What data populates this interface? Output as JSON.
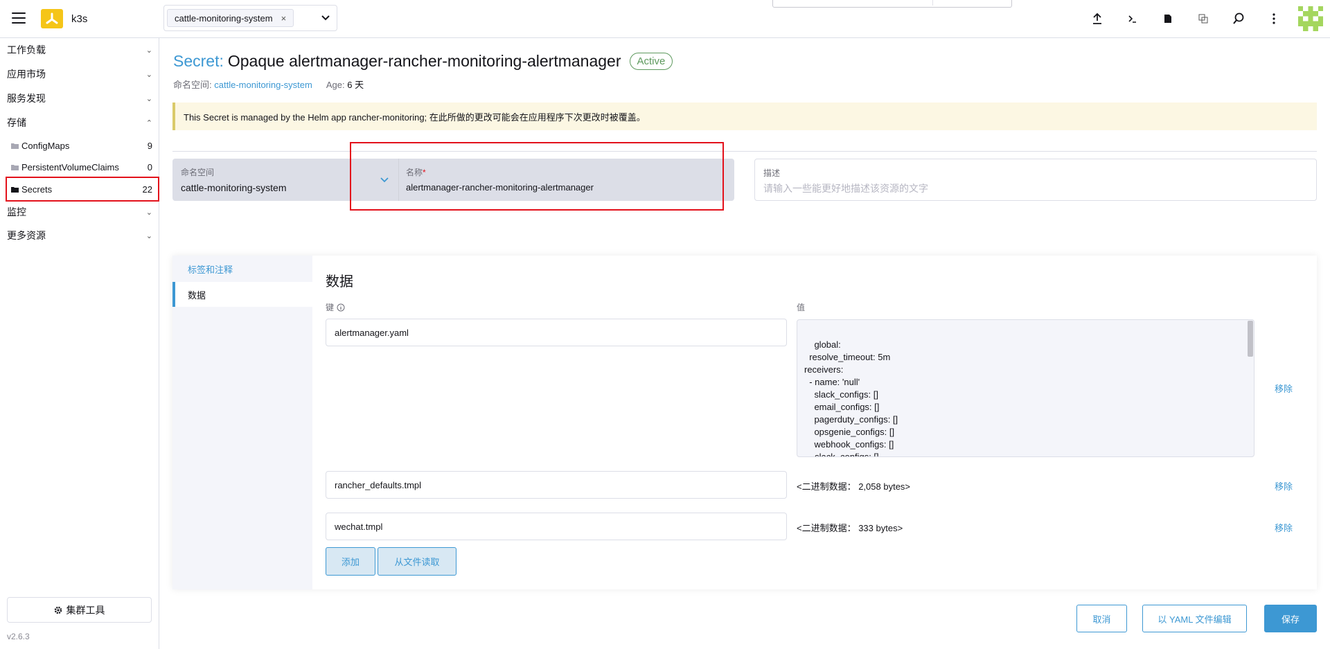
{
  "header": {
    "cluster_name": "k3s",
    "namespace_chip": "cattle-monitoring-system",
    "chip_remove": "×",
    "icons": [
      "upload-icon",
      "terminal-icon",
      "file-icon",
      "copy-icon",
      "search-icon",
      "more-icon"
    ]
  },
  "sidebar": {
    "groups": {
      "workload": "工作负载",
      "apps": "应用市场",
      "service_discovery": "服务发现",
      "storage": "存储",
      "monitoring": "监控",
      "more_resources": "更多资源"
    },
    "items": [
      {
        "label": "ConfigMaps",
        "count": "9"
      },
      {
        "label": "PersistentVolumeClaims",
        "count": "0"
      },
      {
        "label": "Secrets",
        "count": "22"
      }
    ],
    "cluster_tools": "集群工具",
    "version": "v2.6.3"
  },
  "page": {
    "title_prefix": "Secret:",
    "title": "Opaque alertmanager-rancher-monitoring-alertmanager",
    "status": "Active",
    "namespace_label": "命名空间:",
    "namespace_value": "cattle-monitoring-system",
    "age_label": "Age:",
    "age_value": "6 天",
    "banner": "This Secret is managed by the Helm app rancher-monitoring; 在此所做的更改可能会在应用程序下次更改时被覆盖。"
  },
  "form": {
    "namespace_label": "命名空间",
    "namespace_value": "cattle-monitoring-system",
    "name_label": "名称",
    "name_required": "*",
    "name_value": "alertmanager-rancher-monitoring-alertmanager",
    "description_label": "描述",
    "description_placeholder": "请输入一些能更好地描述该资源的文字"
  },
  "tabs": {
    "labels_annotations": "标签和注释",
    "data": "数据"
  },
  "data_panel": {
    "title": "数据",
    "key_header": "键",
    "value_header": "值",
    "entries": [
      {
        "key": "alertmanager.yaml",
        "value": "global:\n  resolve_timeout: 5m\nreceivers:\n  - name: 'null'\n    slack_configs: []\n    email_configs: []\n    pagerduty_configs: []\n    opsgenie_configs: []\n    webhook_configs: []\n  - slack_configs: []\n    email_configs: []",
        "remove": "移除"
      },
      {
        "key": "rancher_defaults.tmpl",
        "value": "<二进制数据：  2,058 bytes>",
        "remove": "移除"
      },
      {
        "key": "wechat.tmpl",
        "value": "<二进制数据：  333 bytes>",
        "remove": "移除"
      }
    ],
    "add_button": "添加",
    "read_file_button": "从文件读取"
  },
  "footer": {
    "cancel": "取消",
    "edit_yaml": "以 YAML 文件编辑",
    "save": "保存"
  },
  "colors": {
    "accent": "#3d98d3",
    "highlight_red": "#e3111b",
    "active_green": "#5d995d",
    "banner_bg": "#fcf7e3"
  }
}
